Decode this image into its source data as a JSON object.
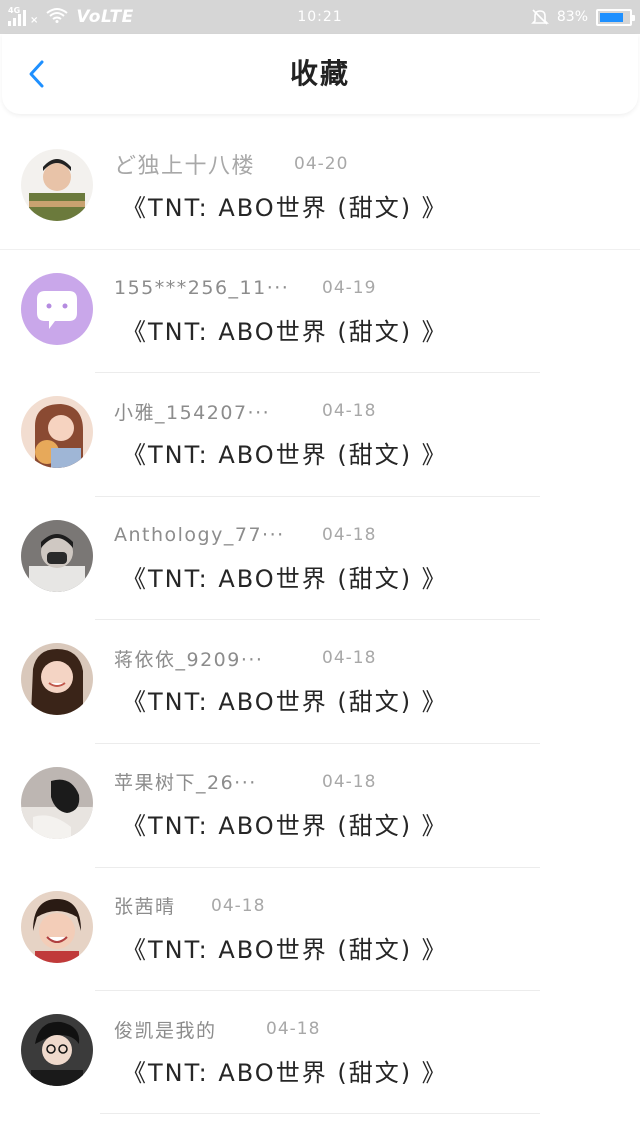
{
  "status_bar": {
    "network": "4G",
    "volte": "VoLTE",
    "time": "10:21",
    "battery_percent": "83%",
    "battery_level": 0.83
  },
  "header": {
    "title": "收藏",
    "back_icon": "chevron-left-icon"
  },
  "favorites": [
    {
      "username": "ど独上十八楼",
      "date": "04-20",
      "book": "《TNT: ABO世界 (甜文) 》"
    },
    {
      "username": "155***256_11···",
      "date": "04-19",
      "book": "《TNT: ABO世界 (甜文) 》"
    },
    {
      "username": "小雅_154207···",
      "date": "04-18",
      "book": "《TNT: ABO世界 (甜文) 》"
    },
    {
      "username": "Anthology_77···",
      "date": "04-18",
      "book": "《TNT: ABO世界 (甜文) 》"
    },
    {
      "username": "蒋依依_9209···",
      "date": "04-18",
      "book": "《TNT: ABO世界 (甜文) 》"
    },
    {
      "username": "苹果树下_26···",
      "date": "04-18",
      "book": "《TNT: ABO世界 (甜文) 》"
    },
    {
      "username": "张茜晴",
      "date": "04-18",
      "book": "《TNT: ABO世界 (甜文) 》"
    },
    {
      "username": "俊凯是我的",
      "date": "04-18",
      "book": "《TNT: ABO世界 (甜文) 》"
    }
  ],
  "colors": {
    "accent": "#1e90ff",
    "status_bar_bg": "#d6d6d6",
    "username_gray": "#8c8c8c",
    "date_gray": "#a8a8a8"
  }
}
